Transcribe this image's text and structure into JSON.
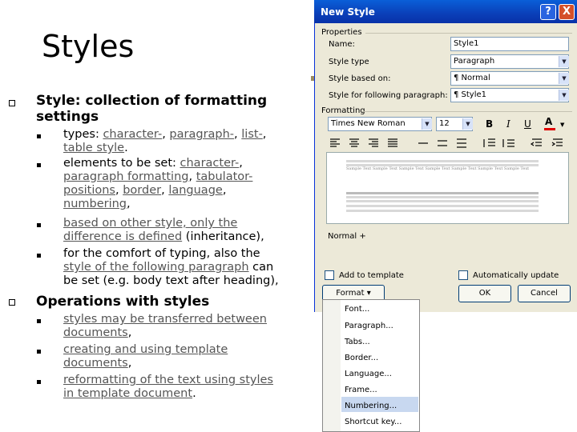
{
  "slide": {
    "title": "Styles",
    "bullets": [
      {
        "text": "Style: collection of formatting settings",
        "subs": [
          [
            {
              "t": "types: ",
              "u": false
            },
            {
              "t": "character-",
              "u": true
            },
            {
              "t": ", ",
              "u": false
            },
            {
              "t": "paragraph-",
              "u": true
            },
            {
              "t": ", ",
              "u": false
            },
            {
              "t": "list-",
              "u": true
            },
            {
              "t": ",",
              "u": false
            },
            {
              "t": "\n",
              "u": false
            },
            {
              "t": "table style",
              "u": true
            },
            {
              "t": ".",
              "u": false
            }
          ],
          [
            {
              "t": "elements to be set: ",
              "u": false
            },
            {
              "t": "character-",
              "u": true
            },
            {
              "t": ",",
              "u": false
            },
            {
              "t": "\n",
              "u": false
            },
            {
              "t": "paragraph formatting",
              "u": true
            },
            {
              "t": ", ",
              "u": false
            },
            {
              "t": "tabulator-",
              "u": true
            },
            {
              "t": "\n",
              "u": false
            },
            {
              "t": "positions",
              "u": true
            },
            {
              "t": ", ",
              "u": false
            },
            {
              "t": "border",
              "u": true
            },
            {
              "t": ", ",
              "u": false
            },
            {
              "t": "language",
              "u": true
            },
            {
              "t": ",",
              "u": false
            },
            {
              "t": "\n",
              "u": false
            },
            {
              "t": "numbering",
              "u": true
            },
            {
              "t": ",",
              "u": false
            }
          ],
          [
            {
              "t": "based on other style, only the",
              "u": true
            },
            {
              "t": "\n",
              "u": false
            },
            {
              "t": "difference is defined",
              "u": true
            },
            {
              "t": " (inheritance),",
              "u": false
            }
          ],
          [
            {
              "t": "for the comfort of typing, also the",
              "u": false
            },
            {
              "t": "\n",
              "u": false
            },
            {
              "t": "style of the following paragraph",
              "u": true
            },
            {
              "t": " can",
              "u": false
            },
            {
              "t": "\n",
              "u": false
            },
            {
              "t": "be set (e.g. body text after heading),",
              "u": false
            }
          ]
        ]
      },
      {
        "text": "Operations with styles",
        "subs": [
          [
            {
              "t": "styles may be transferred between",
              "u": true
            },
            {
              "t": "\n",
              "u": false
            },
            {
              "t": "documents",
              "u": true
            },
            {
              "t": ",",
              "u": false
            }
          ],
          [
            {
              "t": "creating and using template",
              "u": true
            },
            {
              "t": "\n",
              "u": false
            },
            {
              "t": "documents",
              "u": true
            },
            {
              "t": ",",
              "u": false
            }
          ],
          [
            {
              "t": "reformatting of the text using styles",
              "u": true
            },
            {
              "t": "\n",
              "u": false
            },
            {
              "t": "in template document",
              "u": true
            },
            {
              "t": ".",
              "u": false
            }
          ]
        ]
      }
    ]
  },
  "dialog": {
    "title": "New Style",
    "help_label": "?",
    "close_label": "X",
    "properties_label": "Properties",
    "name_label": "Name:",
    "name_value": "Style1",
    "style_type_label": "Style type",
    "style_type_value": "Paragraph",
    "based_on_label": "Style based on:",
    "based_on_value": "¶ Normal",
    "following_label": "Style for following paragraph:",
    "following_value": "¶ Style1",
    "formatting_label": "Formatting",
    "font_value": "Times New Roman",
    "size_value": "12",
    "bold_label": "B",
    "italic_label": "I",
    "underline_label": "U",
    "font_color_label": "A",
    "preview_sample": "Sample Text Sample Text Sample Text Sample Text Sample Text Sample Text Sample Text",
    "description": "Normal +",
    "add_to_template_label": "Add to template",
    "auto_update_label": "Automatically update",
    "format_label": "Format ▾",
    "ok_label": "OK",
    "cancel_label": "Cancel"
  },
  "format_menu": {
    "items": [
      "Font...",
      "Paragraph...",
      "Tabs...",
      "Border...",
      "Language...",
      "Frame...",
      "Numbering...",
      "Shortcut key..."
    ]
  },
  "colors": {
    "titlebar": "#0a3fb8",
    "dialog_bg": "#ece9d8",
    "menu_highlight": "#c8d8f0"
  }
}
